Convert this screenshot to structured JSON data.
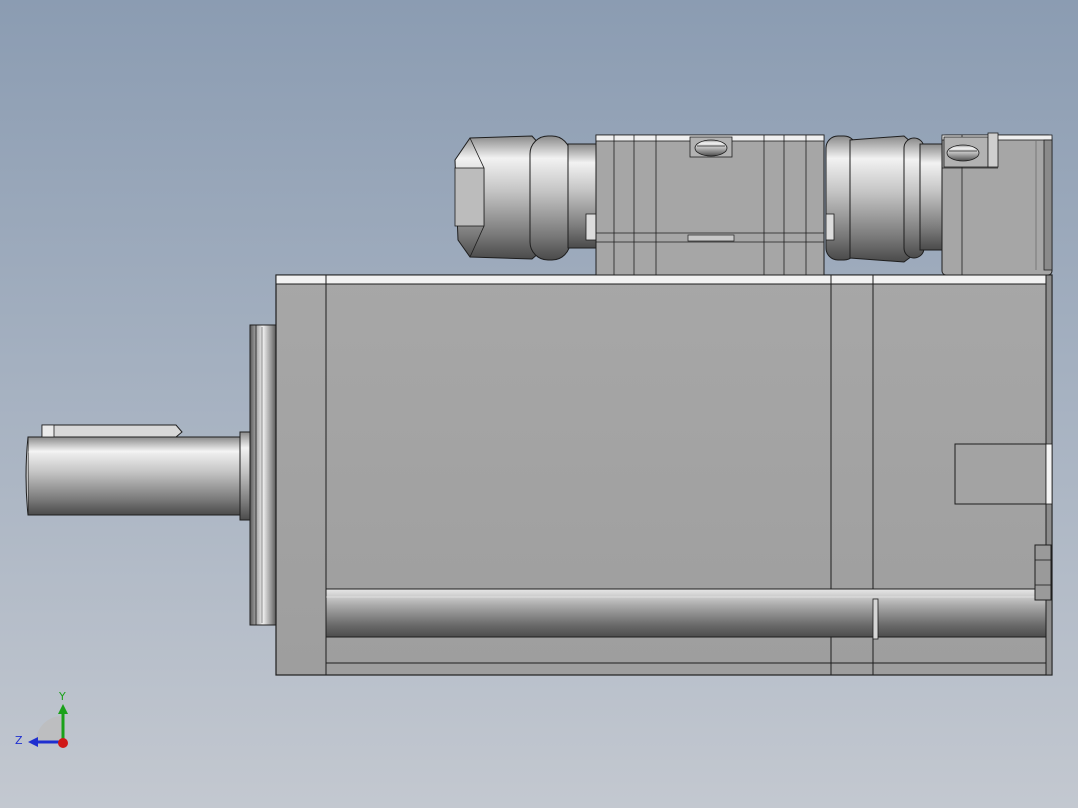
{
  "viewport": {
    "background_top": "#8b9cb2",
    "background_bottom": "#c3c8d0"
  },
  "model": {
    "part_color": "#a3a3a3",
    "edge_color": "#1e1e1e",
    "highlight_color": "#f2f2f2"
  },
  "triad": {
    "y_label": "Y",
    "z_label": "Z",
    "y_axis_color": "#1aa11a",
    "z_axis_color": "#1f2fd0",
    "x_axis_color": "#d01818"
  }
}
